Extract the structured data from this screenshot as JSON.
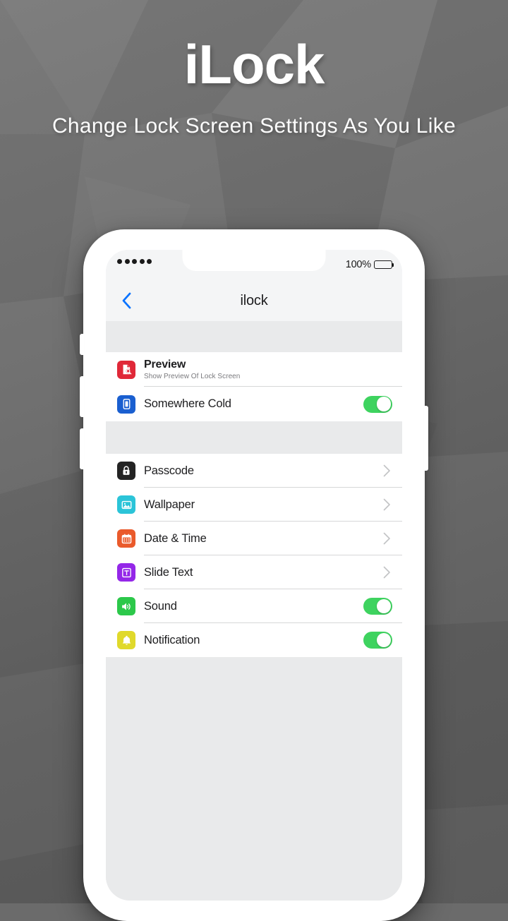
{
  "header": {
    "title": "iLock",
    "subtitle": "Change Lock Screen Settings As You Like"
  },
  "phone": {
    "status_bar": {
      "signal_dots": 5,
      "battery_percent": "100%"
    },
    "nav_bar": {
      "back_icon": "chevron-left-icon",
      "title": "ilock",
      "back_color": "#0a73ff"
    },
    "group_one": [
      {
        "icon": "document-search-icon",
        "icon_color": "#e02838",
        "title": "Preview",
        "subtitle": "Show Preview Of Lock Screen",
        "accessory": "none"
      },
      {
        "icon": "phone-lockscreen-icon",
        "icon_color": "#1a5fd0",
        "title": "Somewhere Cold",
        "subtitle": "",
        "accessory": "toggle",
        "toggle_state": "on"
      }
    ],
    "group_two": [
      {
        "icon": "lock-icon",
        "icon_color": "#232323",
        "title": "Passcode",
        "accessory": "chevron"
      },
      {
        "icon": "image-icon",
        "icon_color": "#2bc4d8",
        "title": "Wallpaper",
        "accessory": "chevron"
      },
      {
        "icon": "calendar-icon",
        "icon_color": "#ea5a2b",
        "title": "Date & Time",
        "accessory": "chevron"
      },
      {
        "icon": "text-icon",
        "icon_color": "#9427e8",
        "title": "Slide Text",
        "accessory": "chevron"
      },
      {
        "icon": "speaker-icon",
        "icon_color": "#2cc84a",
        "title": "Sound",
        "accessory": "toggle",
        "toggle_state": "on"
      },
      {
        "icon": "bell-icon",
        "icon_color": "#e0d92b",
        "title": "Notification",
        "accessory": "toggle",
        "toggle_state": "on"
      }
    ]
  },
  "colors": {
    "toggle_on": "#3ed35f",
    "accent_blue": "#0a73ff",
    "screen_bg": "#e9eaeb",
    "bar_bg": "#f4f5f6"
  }
}
